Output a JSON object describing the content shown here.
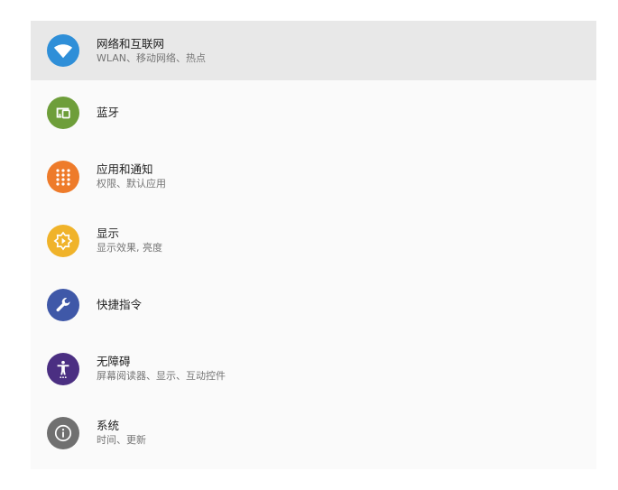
{
  "settings": {
    "items": [
      {
        "title": "网络和互联网",
        "subtitle": "WLAN、移动网络、热点",
        "icon": "wifi-icon",
        "color": "#2f8fd8"
      },
      {
        "title": "蓝牙",
        "subtitle": "",
        "icon": "devices-icon",
        "color": "#6e9e3a"
      },
      {
        "title": "应用和通知",
        "subtitle": "权限、默认应用",
        "icon": "apps-grid-icon",
        "color": "#ee7b2a"
      },
      {
        "title": "显示",
        "subtitle": "显示效果, 亮度",
        "icon": "brightness-icon",
        "color": "#f0b32a"
      },
      {
        "title": "快捷指令",
        "subtitle": "",
        "icon": "wrench-icon",
        "color": "#3f58a8"
      },
      {
        "title": "无障碍",
        "subtitle": "屏幕阅读器、显示、互动控件",
        "icon": "accessibility-icon",
        "color": "#4b2f82"
      },
      {
        "title": "系统",
        "subtitle": "时间、更新",
        "icon": "info-icon",
        "color": "#707070"
      }
    ]
  }
}
